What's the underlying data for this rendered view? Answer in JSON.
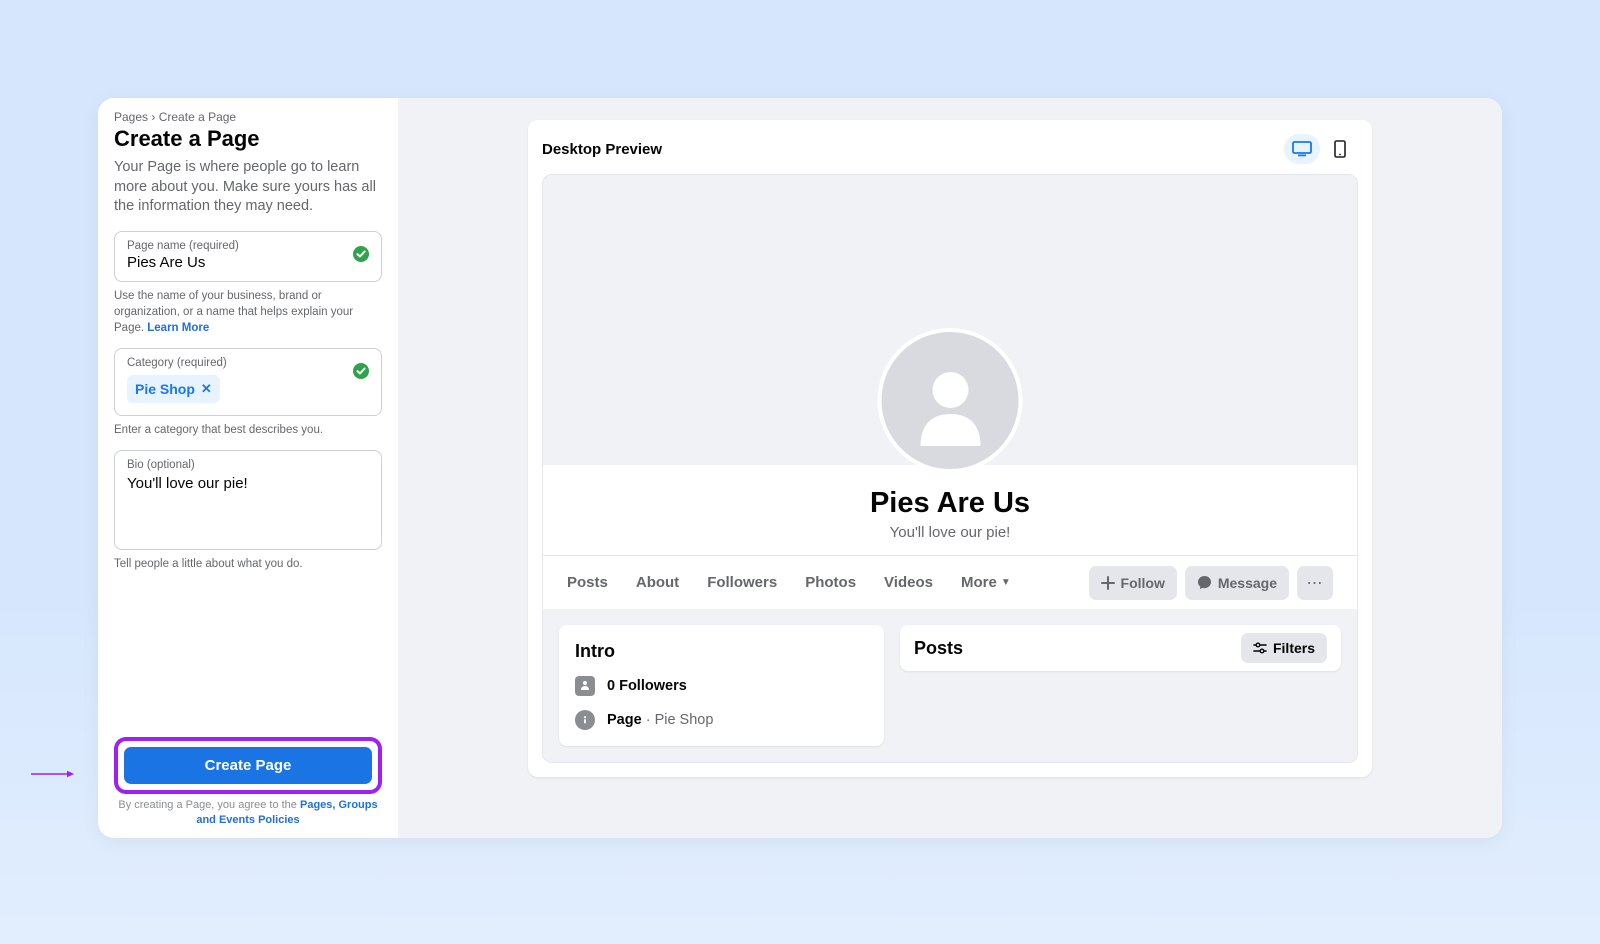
{
  "breadcrumb": {
    "root": "Pages",
    "current": "Create a Page"
  },
  "sidebar": {
    "title": "Create a Page",
    "subtitle": "Your Page is where people go to learn more about you. Make sure yours has all the information they may need.",
    "page_name": {
      "label": "Page name (required)",
      "value": "Pies Are Us",
      "helper": "Use the name of your business, brand or organization, or a name that helps explain your Page.",
      "learn_more": "Learn More"
    },
    "category": {
      "label": "Category (required)",
      "chip": "Pie Shop",
      "helper": "Enter a category that best describes you."
    },
    "bio": {
      "label": "Bio (optional)",
      "value": "You'll love our pie!",
      "helper": "Tell people a little about what you do."
    },
    "create_button": "Create Page",
    "policy_prefix": "By creating a Page, you agree to the ",
    "policy_link": "Pages, Groups and Events Policies"
  },
  "preview": {
    "label": "Desktop Preview",
    "page_name": "Pies Are Us",
    "page_bio": "You'll love our pie!",
    "tabs": [
      "Posts",
      "About",
      "Followers",
      "Photos",
      "Videos",
      "More"
    ],
    "follow_button": "Follow",
    "message_button": "Message",
    "intro": {
      "title": "Intro",
      "followers_label": "0 Followers",
      "page_type_label": "Page",
      "page_category": "Pie Shop"
    },
    "posts": {
      "title": "Posts",
      "filters_button": "Filters"
    }
  }
}
